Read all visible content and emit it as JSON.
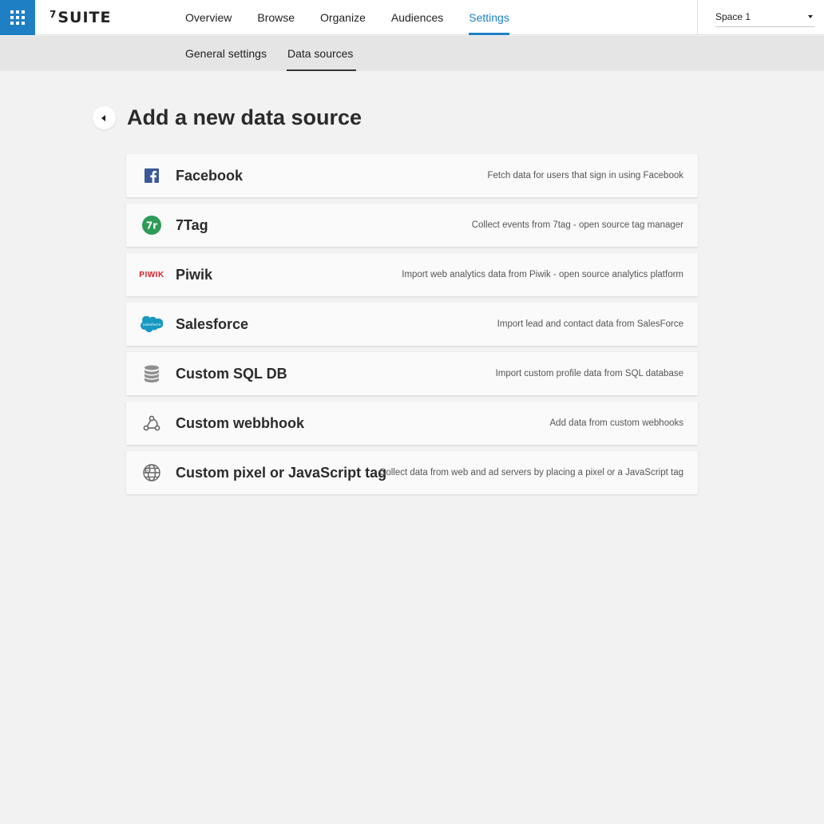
{
  "topbar": {
    "logo": "SUITE",
    "logo_mark": "7",
    "nav": [
      {
        "label": "Overview"
      },
      {
        "label": "Browse"
      },
      {
        "label": "Organize"
      },
      {
        "label": "Audiences"
      },
      {
        "label": "Settings",
        "active": true
      }
    ],
    "space_select": {
      "value": "Space 1"
    }
  },
  "subnav": [
    {
      "label": "General settings"
    },
    {
      "label": "Data sources",
      "active": true
    }
  ],
  "page": {
    "title": "Add a new data source"
  },
  "sources": [
    {
      "name": "Facebook",
      "description": "Fetch data for users that sign in using Facebook",
      "icon": "facebook-icon"
    },
    {
      "name": "7Tag",
      "description": "Collect events from 7tag - open source tag manager",
      "icon": "7tag-icon"
    },
    {
      "name": "Piwik",
      "description": "Import web analytics data from Piwik - open source analytics platform",
      "icon": "piwik-logo-icon",
      "icon_text": "PIWIK"
    },
    {
      "name": "Salesforce",
      "description": "Import lead and contact data from SalesForce",
      "icon": "salesforce-icon"
    },
    {
      "name": "Custom SQL DB",
      "description": "Import custom profile data from SQL database",
      "icon": "database-icon"
    },
    {
      "name": "Custom webbhook",
      "description": "Add data from custom webhooks",
      "icon": "webhook-icon"
    },
    {
      "name": "Custom pixel or JavaScript tag",
      "description": "Collect data from web and ad servers by placing a pixel or a JavaScript tag",
      "icon": "globe-pin-icon"
    }
  ],
  "colors": {
    "accent": "#1f7fc4",
    "facebook": "#3b5998",
    "sevenTag": "#2e9b57",
    "piwik": "#d4202a",
    "salesforce": "#1798c1"
  }
}
